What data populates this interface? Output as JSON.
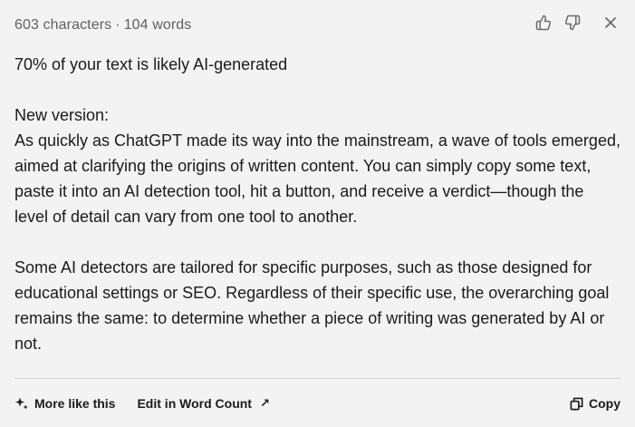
{
  "stats": {
    "characters": "603 characters",
    "separator": "·",
    "words": "104 words"
  },
  "actions": {
    "like": "thumbs-up-icon",
    "dislike": "thumbs-down-icon",
    "close": "close-icon"
  },
  "result": {
    "score_line": "70% of your text is likely AI-generated",
    "new_version_label": "New version:",
    "paragraph1": "As quickly as ChatGPT made its way into the mainstream, a wave of tools emerged, aimed at clarifying the origins of written content. You can simply copy some text, paste it into an AI detection tool, hit a button, and receive a verdict—though the level of detail can vary from one tool to another.",
    "paragraph2": "Some AI detectors are tailored for specific purposes, such as those designed for educational settings or SEO. Regardless of their specific use, the overarching goal remains the same: to determine whether a piece of writing was generated by AI or not."
  },
  "footer": {
    "more_label": "More like this",
    "edit_label": "Edit in Word Count",
    "edit_arrow": "↗",
    "copy_label": "Copy"
  }
}
